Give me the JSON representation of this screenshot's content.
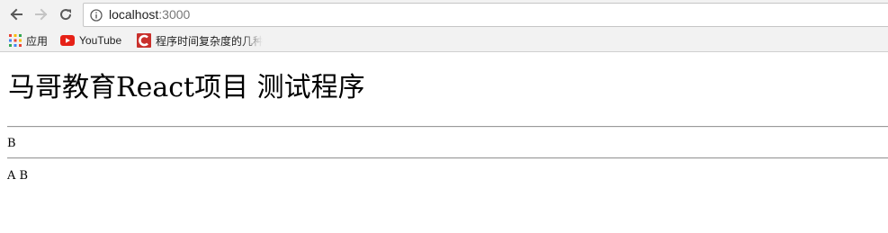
{
  "browser": {
    "url_host": "localhost",
    "url_port": ":3000",
    "icons": {
      "back": "arrow-left-icon",
      "forward": "arrow-right-icon",
      "reload": "reload-icon",
      "site_info": "info-circle-icon"
    },
    "bookmarks": [
      {
        "label": "应用",
        "icon": "apps-grid-icon"
      },
      {
        "label": "YouTube",
        "icon": "youtube-icon",
        "color": "#e62117"
      },
      {
        "label": "程序时间复杂度的几种",
        "icon": "csdn-c-icon",
        "color": "#c9302c"
      }
    ]
  },
  "page": {
    "title": "马哥教育React项目 测试程序",
    "line1": "B",
    "line2": "A B"
  }
}
